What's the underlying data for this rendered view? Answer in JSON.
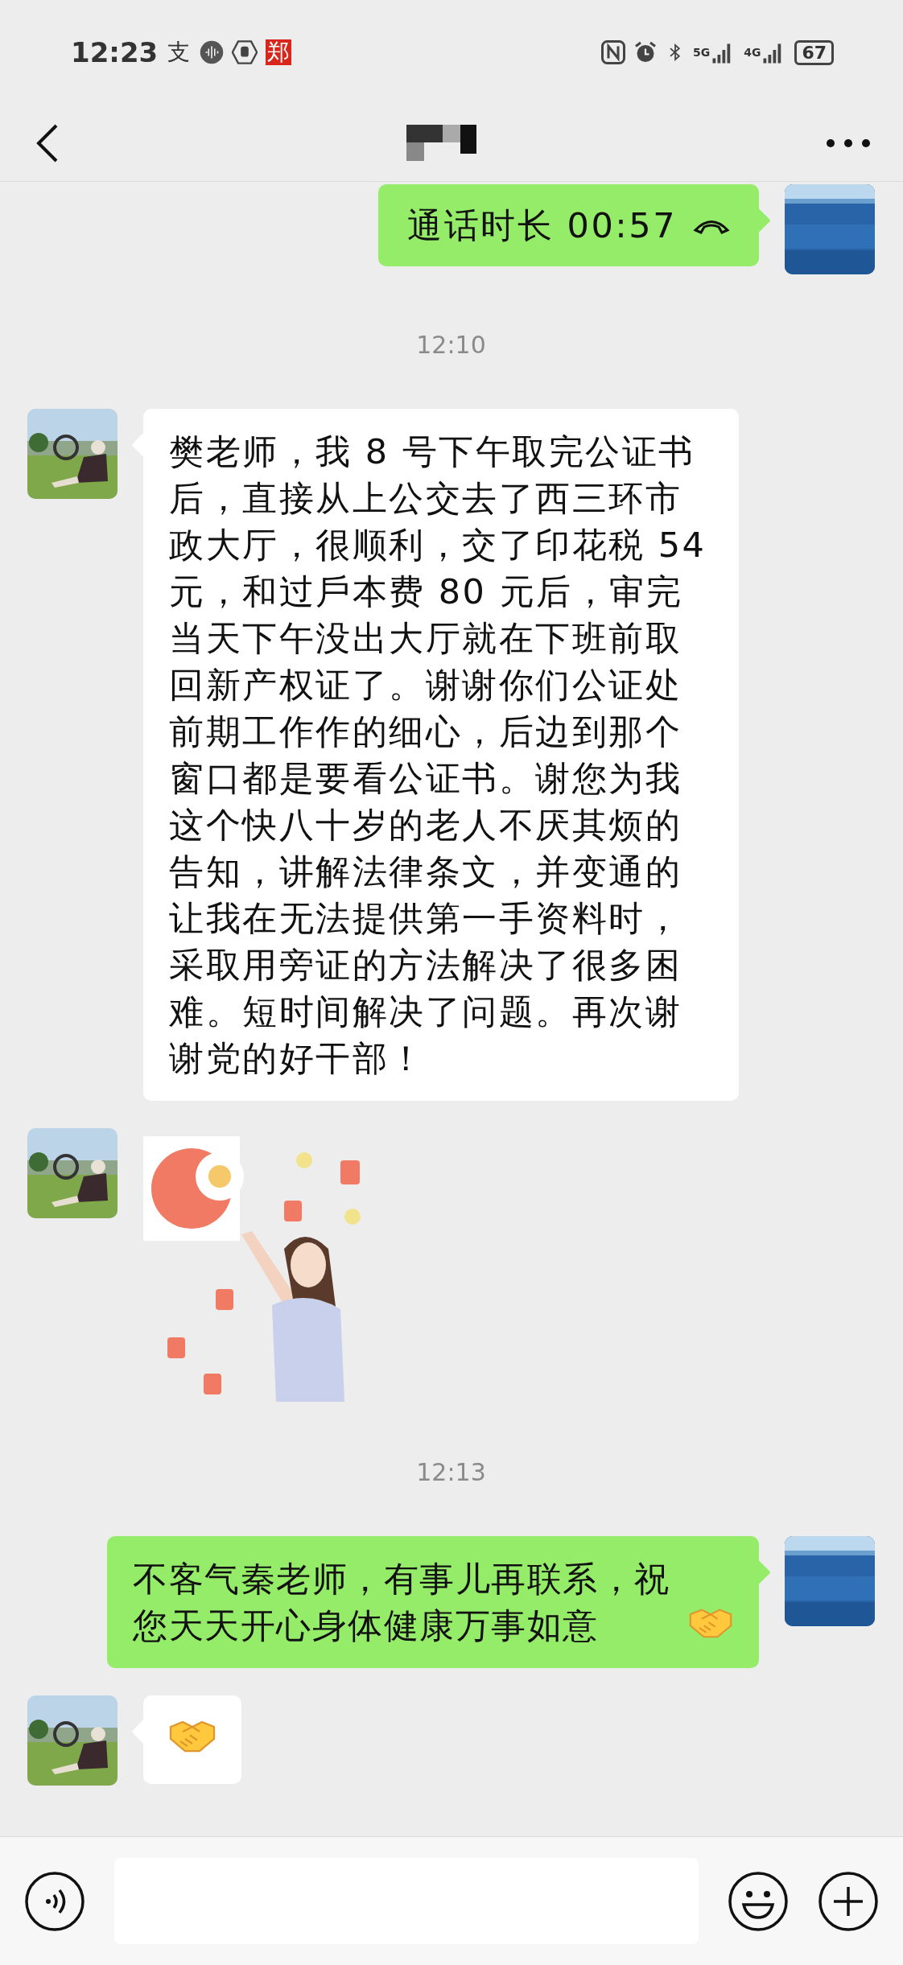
{
  "status_bar": {
    "time": "12:23",
    "app_glyphs": [
      {
        "text": "支",
        "kind": "plain"
      },
      {
        "text": "郑",
        "kind": "badge"
      }
    ],
    "networks": [
      "5G",
      "4G"
    ],
    "battery": "67"
  },
  "messages": [
    {
      "kind": "call",
      "outgoing": true,
      "text": "通话时长 00:57"
    },
    {
      "kind": "time",
      "text": "12:10"
    },
    {
      "kind": "text",
      "outgoing": false,
      "text": "樊老师，我 8 号下午取完公证书后，直接从上公交去了西三环市政大厅，很顺利，交了印花税 54 元，和过戶本费 80 元后，审完当天下午没出大厅就在下班前取回新产权证了。谢谢你们公证处前期工作作的细心，后边到那个窗口都是要看公证书。谢您为我这个快八十岁的老人不厌其烦的告知，讲解法律条文，并变通的让我在无法提供第一手资料时，采取用旁证的方法解决了很多困难。短时间解决了问题。再次谢谢党的好干部！"
    },
    {
      "kind": "sticker",
      "outgoing": false
    },
    {
      "kind": "time",
      "text": "12:13"
    },
    {
      "kind": "text",
      "outgoing": true,
      "text": "不客气秦老师，有事儿再联系，祝您天天开心身体健康万事如意",
      "handshake": true
    },
    {
      "kind": "emoji",
      "outgoing": false
    }
  ]
}
